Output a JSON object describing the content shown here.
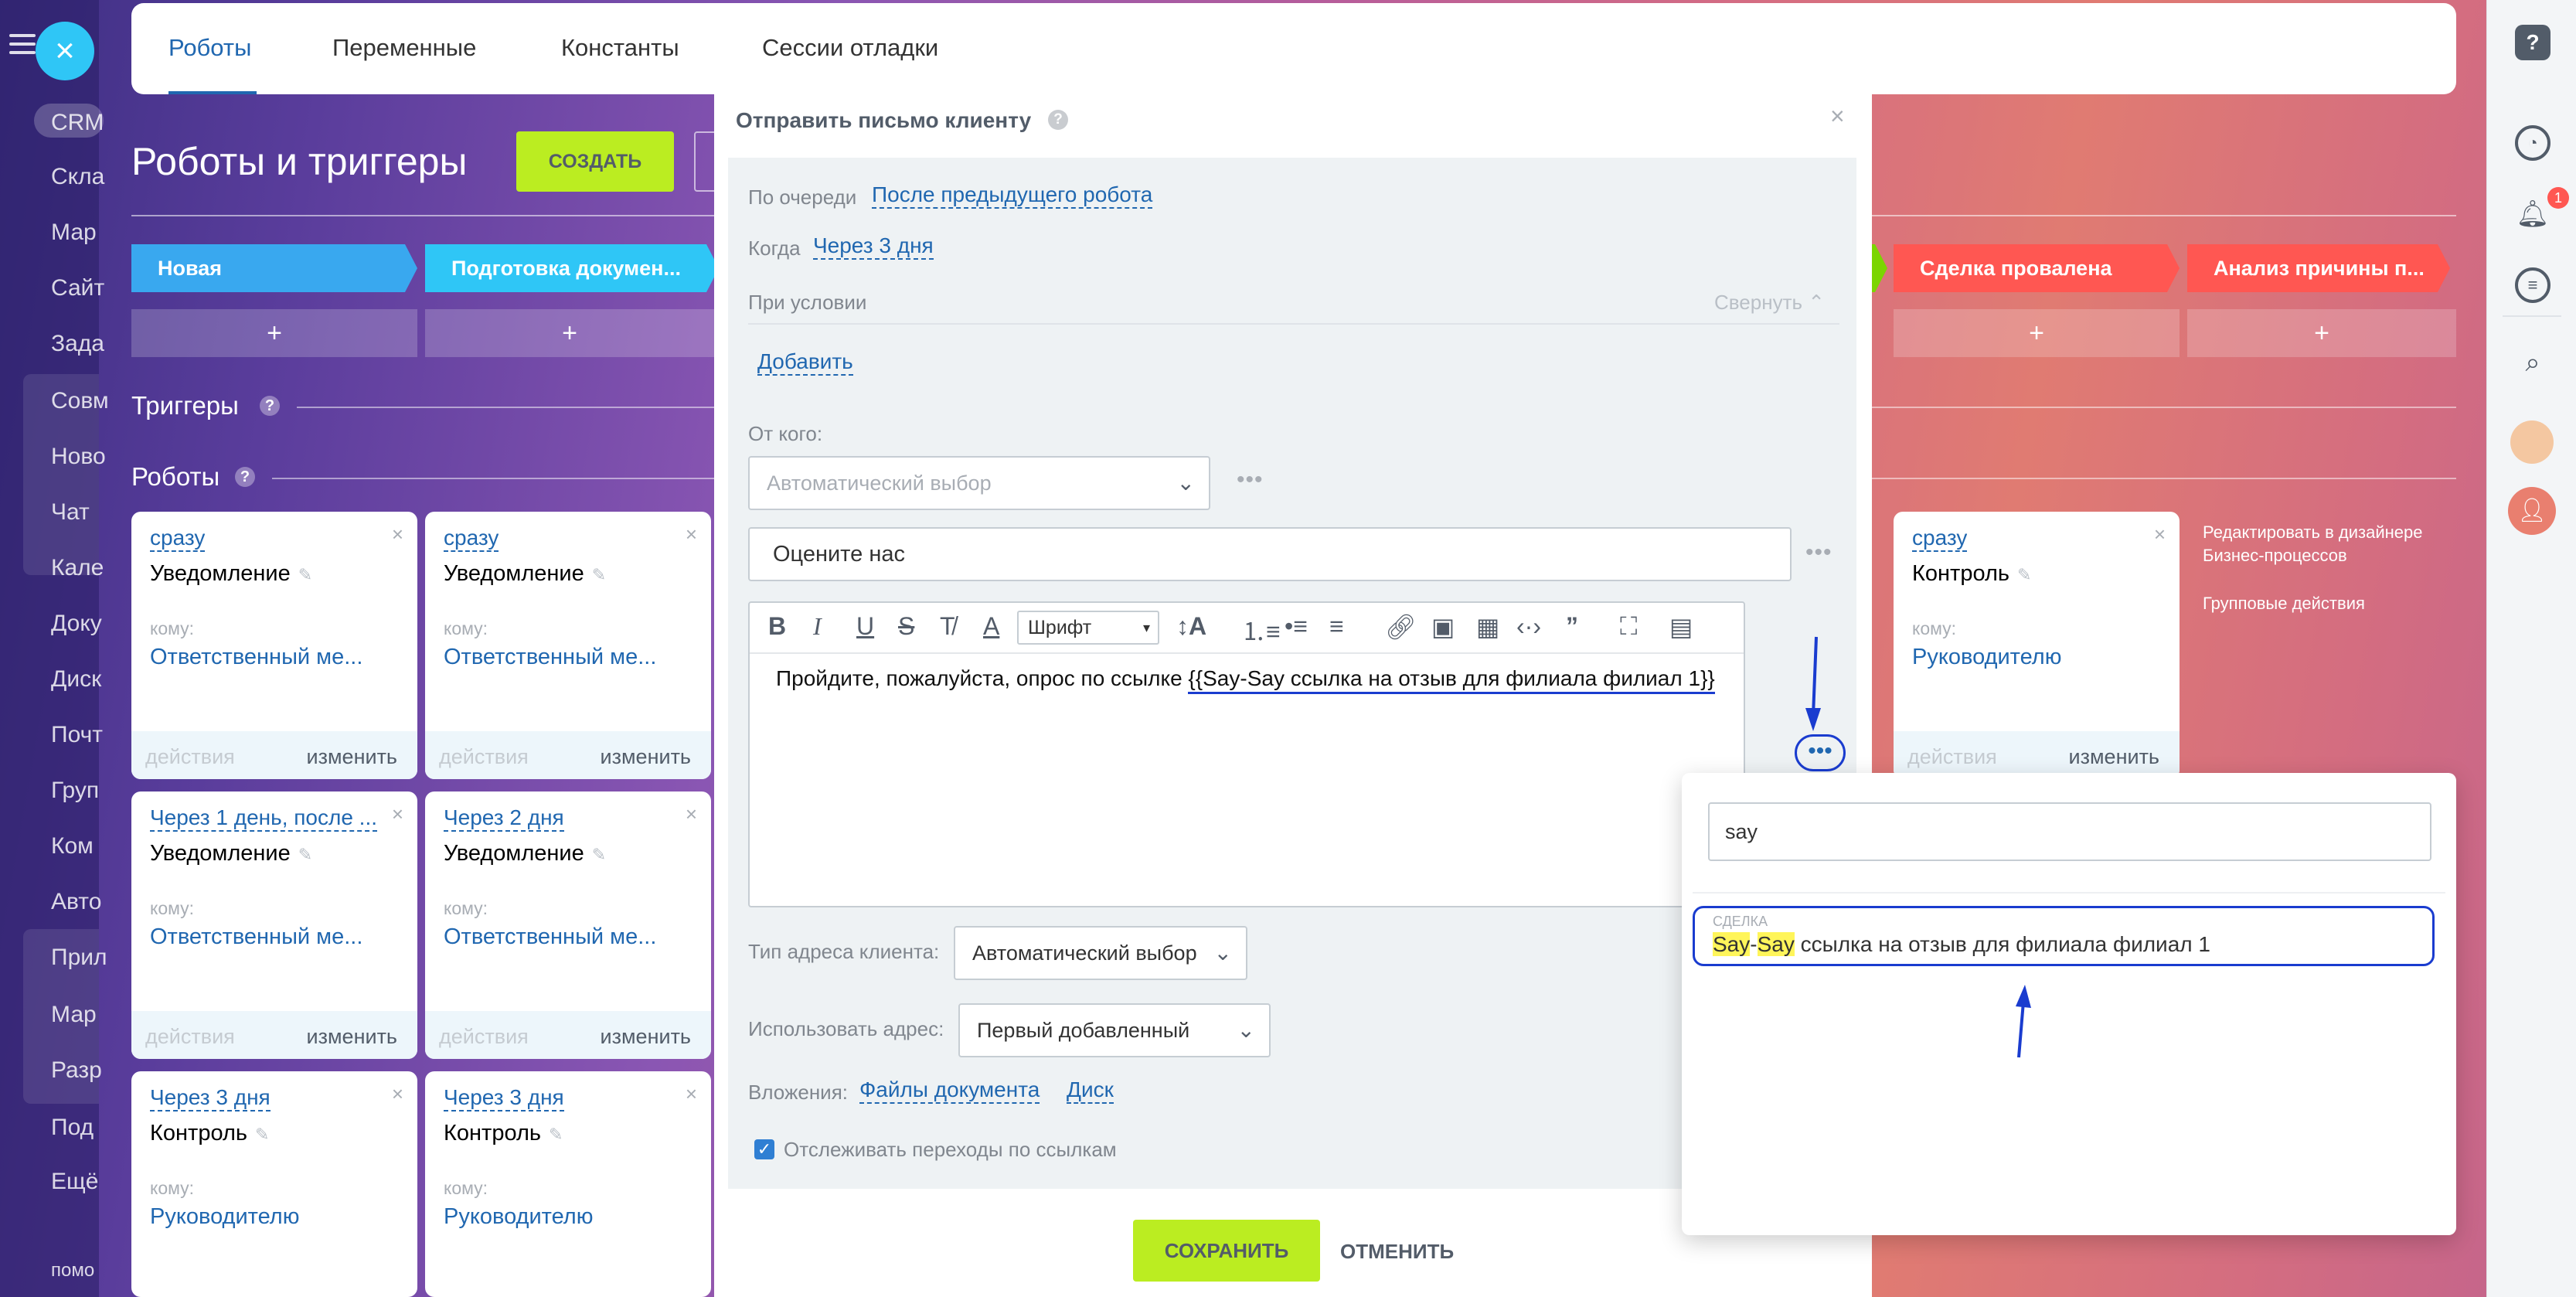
{
  "left_menu": {
    "items": [
      "CRM",
      "Скла",
      "Мар",
      "Сайт",
      "Зада",
      "Совм",
      "Ново",
      "Чат",
      "Кале",
      "Доку",
      "Диск",
      "Почт",
      "Груп",
      "Ком",
      "Авто",
      "Прил",
      "Мар",
      "Разр",
      "Под",
      "Ещё",
      "помо"
    ]
  },
  "tabs": [
    "Роботы",
    "Переменные",
    "Константы",
    "Сессии отладки"
  ],
  "page": {
    "title": "Роботы и триггеры",
    "create_button": "СОЗДАТЬ"
  },
  "stages_left": [
    "Новая",
    "Подготовка докумен..."
  ],
  "stages_right": [
    "Сделка провалена",
    "Анализ причины п..."
  ],
  "stage_colors": {
    "new": "#39a8ef",
    "prep": "#2fc6f6",
    "failed": "#ff5752",
    "analysis": "#ff5752"
  },
  "plus": "+",
  "sections": {
    "triggers": "Триггеры",
    "robots": "Роботы",
    "help": "?"
  },
  "cards": [
    {
      "when": "сразу",
      "title": "Уведомление",
      "whom": "кому:",
      "target": "Ответственный ме...",
      "actions": "действия",
      "edit": "изменить"
    },
    {
      "when": "сразу",
      "title": "Уведомление",
      "whom": "кому:",
      "target": "Ответственный ме...",
      "actions": "действия",
      "edit": "изменить"
    },
    {
      "when": "Через 1 день, после ...",
      "title": "Уведомление",
      "whom": "кому:",
      "target": "Ответственный ме...",
      "actions": "действия",
      "edit": "изменить"
    },
    {
      "when": "Через 2 дня",
      "title": "Уведомление",
      "whom": "кому:",
      "target": "Ответственный ме...",
      "actions": "действия",
      "edit": "изменить"
    },
    {
      "when": "Через 3 дня",
      "title": "Контроль",
      "whom": "кому:",
      "target": "Руководителю"
    },
    {
      "when": "Через 3 дня",
      "title": "Контроль",
      "whom": "кому:",
      "target": "Руководителю"
    },
    {
      "when": "сразу",
      "title": "Контроль",
      "whom": "кому:",
      "target": "Руководителю",
      "actions": "действия",
      "edit": "изменить"
    }
  ],
  "side_links": {
    "bp_designer": "Редактировать в дизайнере Бизнес-процессов",
    "group_actions": "Групповые действия"
  },
  "modal": {
    "title": "Отправить письмо клиенту",
    "close": "×",
    "queue_label": "По очереди",
    "queue_value": "После предыдущего робота",
    "when_label": "Когда",
    "when_value": "Через 3 дня",
    "condition_label": "При условии",
    "collapse": "Свернуть",
    "add": "Добавить",
    "from_label": "От кого:",
    "from_placeholder": "Автоматический выбор",
    "subject": "Оцените нас",
    "font_select": "Шрифт",
    "body_text": "Пройдите, пожалуйста, опрос по ссылке ",
    "body_template": "{{Say-Say ссылка на отзыв для филиала филиал 1}}",
    "addr_type_label": "Тип адреса клиента:",
    "addr_type_value": "Автоматический выбор",
    "use_addr_label": "Использовать адрес:",
    "use_addr_value": "Первый добавленный",
    "attachments_label": "Вложения:",
    "attach_files": "Файлы документа",
    "attach_disk": "Диск",
    "track_links": "Отслеживать переходы по ссылкам",
    "save": "СОХРАНИТЬ",
    "cancel": "ОТМЕНИТЬ"
  },
  "popup": {
    "search_value": "say",
    "result_category": "СДЕЛКА",
    "result_hl1": "Say",
    "result_dash": "-",
    "result_hl2": "Say",
    "result_rest": " ссылка на отзыв для филиала филиал 1"
  },
  "right_bar": {
    "notification_count": "1"
  },
  "colors": {
    "accent_green": "#bbed21",
    "link_blue": "#2067b0",
    "annotation_blue": "#1a3ccf"
  }
}
